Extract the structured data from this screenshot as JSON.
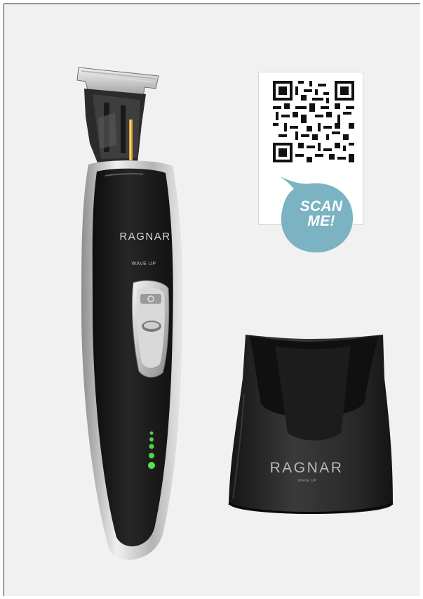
{
  "trimmer": {
    "brand": "RAGNAR",
    "model": "WAVE UP"
  },
  "qr_card": {
    "badge_line1": "SCAN",
    "badge_line2": "ME!"
  },
  "charging_base": {
    "brand": "RAGNAR",
    "subtext": "WAVE UP"
  },
  "colors": {
    "background": "#f1f1f2",
    "trimmer_body": "#1b1b1b",
    "chrome": "#c9c9c9",
    "badge": "#7bb3c2",
    "battery_led": "#4fd14a",
    "base_body": "#2a2a2a"
  }
}
